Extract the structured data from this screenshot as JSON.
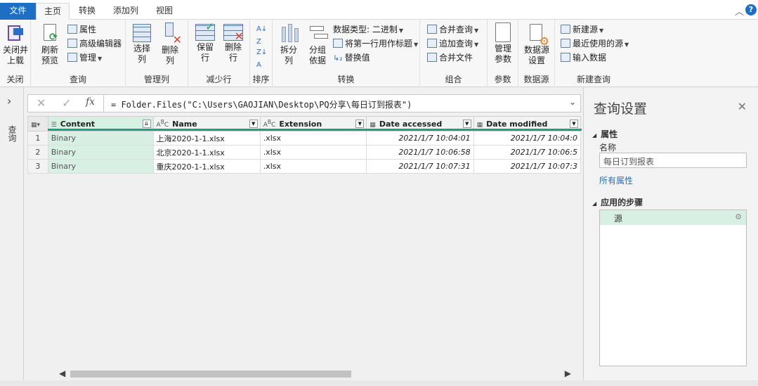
{
  "tabs": {
    "file": "文件",
    "items": [
      "主页",
      "转换",
      "添加列",
      "视图"
    ],
    "help": "?"
  },
  "ribbon": {
    "close_group": {
      "label": "关闭",
      "btn": "关闭并\n上载"
    },
    "query_group": {
      "label": "查询",
      "refresh": "刷新\n预览",
      "properties": "属性",
      "advanced_editor": "高级编辑器",
      "manage": "管理"
    },
    "manage_cols_group": {
      "label": "管理列",
      "choose": "选择\n列",
      "remove": "删除\n列"
    },
    "reduce_rows_group": {
      "label": "减少行",
      "keep": "保留\n行",
      "remove": "删除\n行"
    },
    "sort_group": {
      "label": "排序"
    },
    "transform_group": {
      "label": "转换",
      "split": "拆分\n列",
      "group_by": "分组\n依据",
      "data_type": "数据类型: 二进制",
      "first_row": "将第一行用作标题",
      "replace": "替换值"
    },
    "combine_group": {
      "label": "组合",
      "merge": "合并查询",
      "append": "追加查询",
      "combine_files": "合并文件"
    },
    "params_group": {
      "label": "参数",
      "manage_params": "管理\n参数"
    },
    "datasource_group": {
      "label": "数据源",
      "settings": "数据源\n设置"
    },
    "new_query_group": {
      "label": "新建查询",
      "new_source": "新建源",
      "recent": "最近使用的源",
      "enter_data": "输入数据"
    }
  },
  "leftnav": {
    "label": "查询"
  },
  "formula": {
    "cancel_icon": "✕",
    "ok_icon": "✓",
    "fx": "fx",
    "text": "= Folder.Files(\"C:\\Users\\GAOJIAN\\Desktop\\PQ分享\\每日订到报表\")"
  },
  "grid": {
    "columns": [
      {
        "name": "Content",
        "type": "binary"
      },
      {
        "name": "Name",
        "type": "text"
      },
      {
        "name": "Extension",
        "type": "text"
      },
      {
        "name": "Date accessed",
        "type": "datetime"
      },
      {
        "name": "Date modified",
        "type": "datetime"
      }
    ],
    "rows": [
      {
        "n": "1",
        "content": "Binary",
        "name": "上海2020-1-1.xlsx",
        "ext": ".xlsx",
        "accessed": "2021/1/7 10:04:01",
        "modified": "2021/1/7 10:04:0"
      },
      {
        "n": "2",
        "content": "Binary",
        "name": "北京2020-1-1.xlsx",
        "ext": ".xlsx",
        "accessed": "2021/1/7 10:06:58",
        "modified": "2021/1/7 10:06:5"
      },
      {
        "n": "3",
        "content": "Binary",
        "name": "重庆2020-1-1.xlsx",
        "ext": ".xlsx",
        "accessed": "2021/1/7 10:07:31",
        "modified": "2021/1/7 10:07:3"
      }
    ]
  },
  "settings": {
    "title": "查询设置",
    "properties_header": "属性",
    "name_label": "名称",
    "name_value": "每日订到报表",
    "all_properties": "所有属性",
    "steps_header": "应用的步骤",
    "steps": [
      "源"
    ]
  }
}
